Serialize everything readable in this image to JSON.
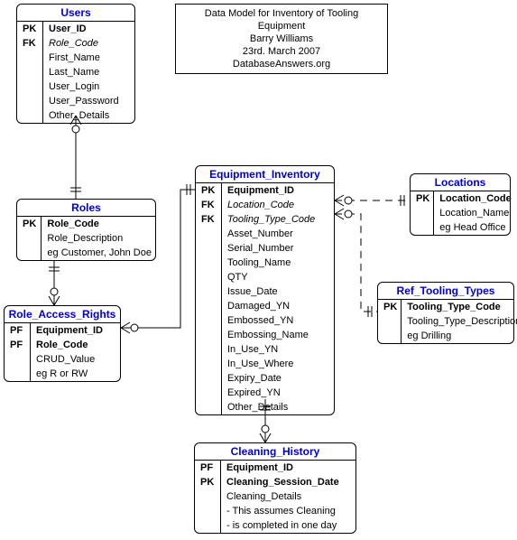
{
  "info": {
    "line1": "Data Model for Inventory of Tooling Equipment",
    "line2": "Barry Williams",
    "line3": "23rd. March 2007",
    "line4": "DatabaseAnswers.org"
  },
  "users": {
    "title": "Users",
    "rows": [
      {
        "key": "PK",
        "name": "User_ID",
        "bold": true
      },
      {
        "key": "FK",
        "name": "Role_Code",
        "fk": true
      },
      {
        "key": "",
        "name": "First_Name"
      },
      {
        "key": "",
        "name": "Last_Name"
      },
      {
        "key": "",
        "name": "User_Login"
      },
      {
        "key": "",
        "name": "User_Password"
      },
      {
        "key": "",
        "name": "Other_Details"
      }
    ]
  },
  "roles": {
    "title": "Roles",
    "rows": [
      {
        "key": "PK",
        "name": "Role_Code",
        "bold": true
      },
      {
        "key": "",
        "name": "Role_Description"
      },
      {
        "key": "",
        "name": "eg Customer, John Doe"
      }
    ]
  },
  "rar": {
    "title": "Role_Access_Rights",
    "rows": [
      {
        "key": "PF",
        "name": "Equipment_ID",
        "bold": true
      },
      {
        "key": "PF",
        "name": "Role_Code",
        "bold": true
      },
      {
        "key": "",
        "name": "CRUD_Value"
      },
      {
        "key": "",
        "name": "eg R or RW"
      }
    ]
  },
  "equip": {
    "title": "Equipment_Inventory",
    "rows": [
      {
        "key": "PK",
        "name": "Equipment_ID",
        "bold": true
      },
      {
        "key": "FK",
        "name": "Location_Code",
        "fk": true
      },
      {
        "key": "FK",
        "name": "Tooling_Type_Code",
        "fk": true
      },
      {
        "key": "",
        "name": "Asset_Number"
      },
      {
        "key": "",
        "name": "Serial_Number"
      },
      {
        "key": "",
        "name": "Tooling_Name"
      },
      {
        "key": "",
        "name": "QTY"
      },
      {
        "key": "",
        "name": "Issue_Date"
      },
      {
        "key": "",
        "name": "Damaged_YN"
      },
      {
        "key": "",
        "name": "Embossed_YN"
      },
      {
        "key": "",
        "name": "Embossing_Name"
      },
      {
        "key": "",
        "name": "In_Use_YN"
      },
      {
        "key": "",
        "name": "In_Use_Where"
      },
      {
        "key": "",
        "name": "Expiry_Date"
      },
      {
        "key": "",
        "name": "Expired_YN"
      },
      {
        "key": "",
        "name": "Other_Details"
      }
    ]
  },
  "locations": {
    "title": "Locations",
    "rows": [
      {
        "key": "PK",
        "name": "Location_Code",
        "bold": true
      },
      {
        "key": "",
        "name": "Location_Name"
      },
      {
        "key": "",
        "name": "eg Head Office"
      }
    ]
  },
  "ref_tooling": {
    "title": "Ref_Tooling_Types",
    "rows": [
      {
        "key": "PK",
        "name": "Tooling_Type_Code",
        "bold": true
      },
      {
        "key": "",
        "name": "Tooling_Type_Description"
      },
      {
        "key": "",
        "name": "eg Drilling"
      }
    ]
  },
  "cleaning": {
    "title": "Cleaning_History",
    "rows": [
      {
        "key": "PF",
        "name": "Equipment_ID",
        "bold": true
      },
      {
        "key": "PK",
        "name": "Cleaning_Session_Date",
        "bold": true
      },
      {
        "key": "",
        "name": "Cleaning_Details"
      },
      {
        "key": "",
        "name": "- This assumes Cleaning"
      },
      {
        "key": "",
        "name": "- is completed in one day"
      }
    ]
  }
}
